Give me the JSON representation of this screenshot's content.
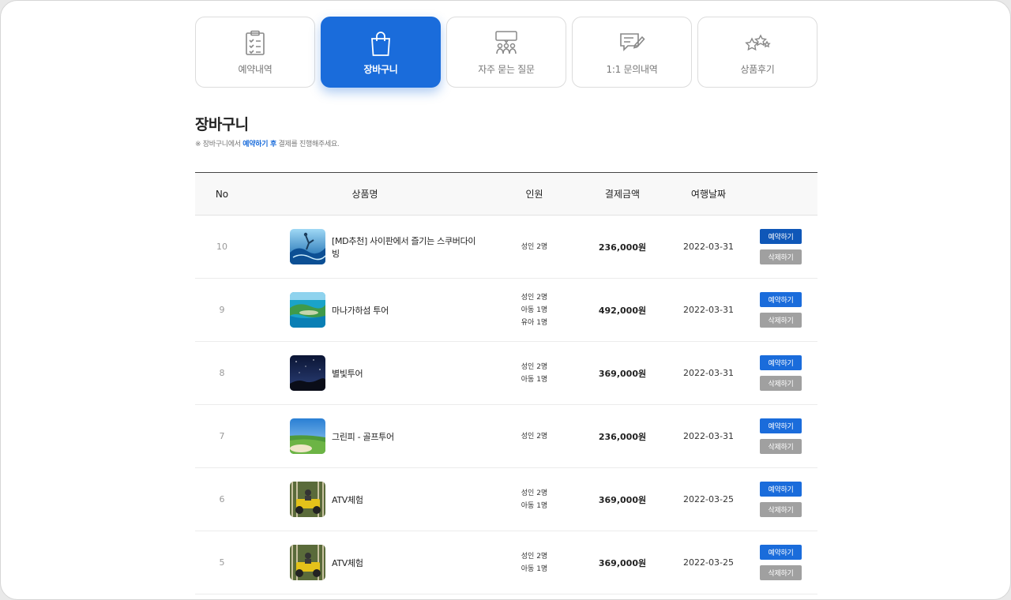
{
  "tabs": [
    {
      "label": "예약내역",
      "icon": "clipboard-checklist-icon"
    },
    {
      "label": "장바구니",
      "icon": "shopping-bag-icon"
    },
    {
      "label": "자주 묻는 질문",
      "icon": "group-speech-icon"
    },
    {
      "label": "1:1 문의내역",
      "icon": "chat-edit-icon"
    },
    {
      "label": "상품후기",
      "icon": "stars-icon"
    }
  ],
  "active_tab": 1,
  "page_title": "장바구니",
  "note": {
    "prefix": "※ 장바구니에서 ",
    "highlight": "예약하기 후",
    "suffix": " 결제를 진행해주세요."
  },
  "columns": {
    "no": "No",
    "product": "상품명",
    "people": "인원",
    "amount": "결제금액",
    "date": "여행날짜"
  },
  "buttons": {
    "book": "예약하기",
    "delete": "삭제하기"
  },
  "rows": [
    {
      "no": "10",
      "name": "[MD추천] 사이판에서 즐기는 스쿠버다이빙",
      "people": [
        "성인 2명"
      ],
      "amount": "236,000원",
      "date": "2022-03-31",
      "thumb": "scuba"
    },
    {
      "no": "9",
      "name": "마나가하섬 투어",
      "people": [
        "성인 2명",
        "아동 1명",
        "유아 1명"
      ],
      "amount": "492,000원",
      "date": "2022-03-31",
      "thumb": "island"
    },
    {
      "no": "8",
      "name": "별빛투어",
      "people": [
        "성인 2명",
        "아동 1명"
      ],
      "amount": "369,000원",
      "date": "2022-03-31",
      "thumb": "stars"
    },
    {
      "no": "7",
      "name": "그린피 - 골프투어",
      "people": [
        "성인 2명"
      ],
      "amount": "236,000원",
      "date": "2022-03-31",
      "thumb": "golf"
    },
    {
      "no": "6",
      "name": "ATV체험",
      "people": [
        "성인 2명",
        "아동 1명"
      ],
      "amount": "369,000원",
      "date": "2022-03-25",
      "thumb": "atv"
    },
    {
      "no": "5",
      "name": "ATV체험",
      "people": [
        "성인 2명",
        "아동 1명"
      ],
      "amount": "369,000원",
      "date": "2022-03-25",
      "thumb": "atv"
    }
  ],
  "colors": {
    "accent": "#1a6cdb",
    "delete": "#a0a0a0"
  }
}
